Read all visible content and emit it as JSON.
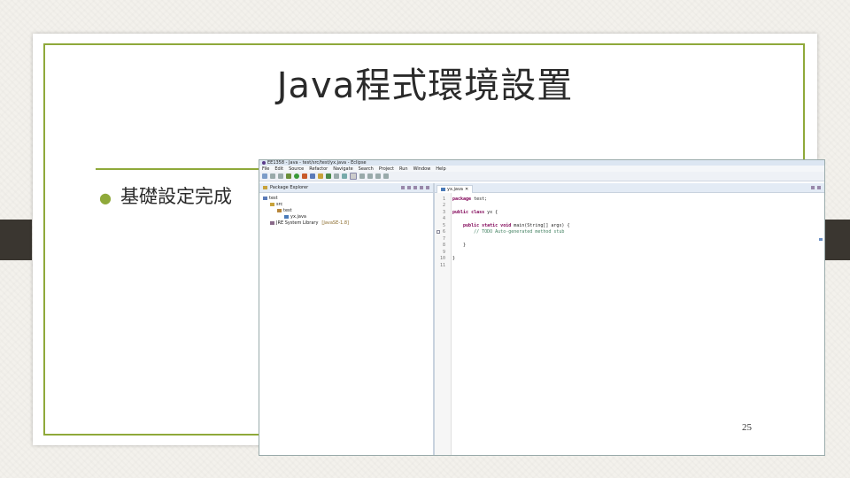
{
  "slide": {
    "title": "Java程式環境設置",
    "bullet": "基礎設定完成",
    "page_number": "25",
    "colors": {
      "accent": "#8fa93a",
      "background": "#f3f1ec",
      "tab": "#3a3630"
    }
  },
  "ide": {
    "window_title": "EE1358 - Java - test/src/test/yx.java - Eclipse",
    "menu": [
      "File",
      "Edit",
      "Source",
      "Refactor",
      "Navigate",
      "Search",
      "Project",
      "Run",
      "Window",
      "Help"
    ],
    "package_explorer": {
      "label": "Package Explorer",
      "tree": [
        {
          "label": "test",
          "icon": "project-icon",
          "indent": 0
        },
        {
          "label": "src",
          "icon": "folder-icon",
          "indent": 1
        },
        {
          "label": "test",
          "icon": "package-icon",
          "indent": 2
        },
        {
          "label": "yx.java",
          "icon": "java-file-icon",
          "indent": 3
        },
        {
          "label": "JRE System Library",
          "note": "[JavaSE-1.8]",
          "icon": "library-icon",
          "indent": 1
        }
      ]
    },
    "editor": {
      "tab_label": "yx.java",
      "lines": [
        {
          "n": "1",
          "text": "package test;",
          "kw": "package",
          "rest": " test;"
        },
        {
          "n": "2",
          "text": ""
        },
        {
          "n": "3",
          "text": "public class yx {",
          "kw": "public class",
          "rest": " yx {"
        },
        {
          "n": "4",
          "text": ""
        },
        {
          "n": "5",
          "text": "    public static void main(String[] args) {",
          "kw": "    public static void",
          "rest": " main(String[] args) {"
        },
        {
          "n": "6",
          "text": "        // TODO Auto-generated method stub",
          "comment": true
        },
        {
          "n": "7",
          "text": ""
        },
        {
          "n": "8",
          "text": "    }"
        },
        {
          "n": "9",
          "text": ""
        },
        {
          "n": "10",
          "text": "}"
        },
        {
          "n": "11",
          "text": ""
        }
      ]
    }
  }
}
